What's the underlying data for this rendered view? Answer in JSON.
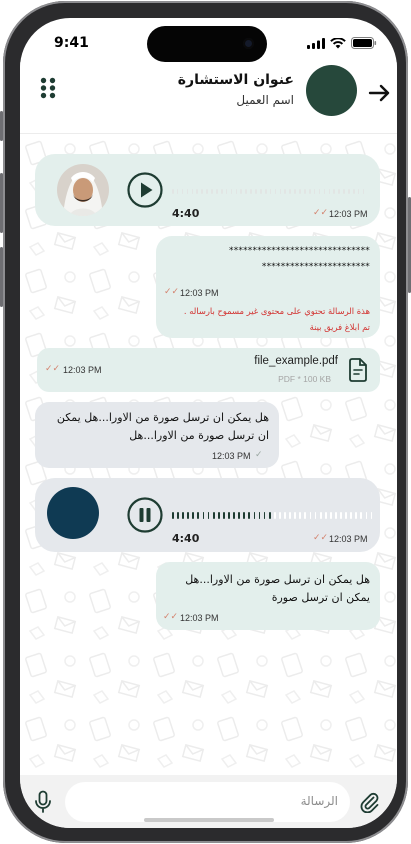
{
  "status_bar": {
    "time": "9:41"
  },
  "header": {
    "title": "عنوان الاستشارة",
    "subtitle": "اسم العميل",
    "back_icon": "arrow-right-icon",
    "menu_icon": "dots-grid-icon"
  },
  "messages": [
    {
      "type": "voice",
      "state": "paused",
      "duration": "4:40",
      "time": "12:03 PM"
    },
    {
      "type": "masked_text",
      "masked_line_1": "******************************",
      "masked_line_2": "***********************",
      "time": "12:03 PM",
      "warning_line_1": "هذة الرسالة تحتوي على محتوى غير مسموح بارساله .",
      "warning_line_2": "تم ابلاغ فريق بينة"
    },
    {
      "type": "file",
      "file_name": "file_example.pdf",
      "file_meta": "PDF * 100 KB",
      "time": "12:03 PM"
    },
    {
      "type": "text",
      "line_1": "هل يمكن ان ترسل صورة من الاورا...هل يمكن",
      "line_2": "ان ترسل صورة من الاورا...هل",
      "time": "12:03 PM"
    },
    {
      "type": "voice",
      "state": "playing",
      "duration": "4:40",
      "time": "12:03 PM"
    },
    {
      "type": "text",
      "line_1": "هل يمكن ان ترسل صورة من الاورا...هل",
      "line_2": "يمكن ان ترسل صورة",
      "time": "12:03 PM"
    }
  ],
  "composer": {
    "placeholder": "الرسالة",
    "mic_icon": "microphone-icon",
    "attach_icon": "paperclip-icon"
  },
  "colors": {
    "accent_dark": "#1e3c32",
    "bubble_green": "#e3efec",
    "bubble_grey": "#e5e8ec",
    "warning_red": "#d2312f",
    "tick_color": "#d3816c",
    "voice_avatar_blue": "#0f3a53"
  }
}
